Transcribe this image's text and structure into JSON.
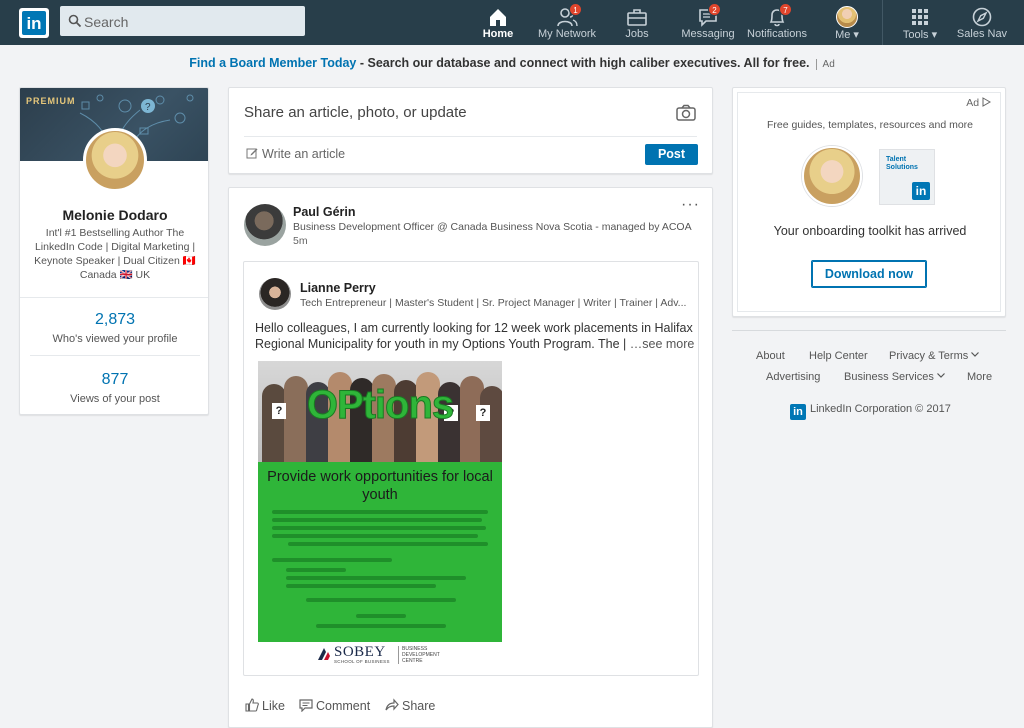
{
  "nav": {
    "search_placeholder": "Search",
    "items": [
      {
        "label": "Home",
        "icon": "home-icon"
      },
      {
        "label": "My Network",
        "icon": "people-icon",
        "badge": "1"
      },
      {
        "label": "Jobs",
        "icon": "briefcase-icon"
      },
      {
        "label": "Messaging",
        "icon": "messaging-icon",
        "badge": "2"
      },
      {
        "label": "Notifications",
        "icon": "bell-icon",
        "badge": "7"
      },
      {
        "label": "Me",
        "icon": "avatar"
      },
      {
        "label": "Tools",
        "icon": "grid-icon"
      },
      {
        "label": "Sales Nav",
        "icon": "compass-icon"
      }
    ],
    "active": "Home"
  },
  "ad_banner": {
    "link": "Find a Board Member Today",
    "separator": " - ",
    "text": "Search our database and connect with high caliber executives. All for free.",
    "tag": "Ad"
  },
  "profile": {
    "premium_label": "PREMIUM",
    "name": "Melonie Dodaro",
    "headline": "Int'l #1 Bestselling Author The LinkedIn Code | Digital Marketing | Keynote Speaker | Dual Citizen 🇨🇦 Canada 🇬🇧 UK",
    "stats": [
      {
        "value": "2,873",
        "label": "Who's viewed your profile"
      },
      {
        "value": "877",
        "label": "Views of your post"
      }
    ]
  },
  "share": {
    "prompt": "Share an article, photo, or update",
    "write_article": "Write an article",
    "post_label": "Post"
  },
  "post": {
    "author": "Paul Gérin",
    "headline": "Business Development Officer @ Canada Business Nova Scotia - managed by ACOA",
    "time": "5m",
    "more": "···",
    "shared": {
      "author": "Lianne Perry",
      "headline": "Tech Entrepreneur | Master's Student | Sr. Project Manager | Writer | Trainer | Adv...",
      "text": "Hello colleagues, I am currently looking for 12 week work placements in Halifax Regional Municipality for youth in my Options Youth Program. The |",
      "see_more": "…see more",
      "poster": {
        "title": "OPtions",
        "heading": "Provide work opportunities for local youth",
        "school": "SOBEY",
        "school_sub": "SCHOOL OF BUSINESS",
        "centre": "BUSINESS\nDEVELOPMENT\nCENTRE"
      }
    },
    "actions": [
      {
        "label": "Like",
        "icon": "thumbs-up-icon"
      },
      {
        "label": "Comment",
        "icon": "comment-icon"
      },
      {
        "label": "Share",
        "icon": "share-arrow-icon"
      }
    ]
  },
  "right_ad": {
    "tag": "Ad",
    "subtitle": "Free guides, templates, resources and more",
    "logo_text": "Talent\nSolutions",
    "logo_mark": "in",
    "message": "Your onboarding toolkit has arrived",
    "button": "Download now"
  },
  "footer": {
    "links": [
      "About",
      "Help Center",
      "Privacy & Terms",
      "Advertising",
      "Business Services",
      "More"
    ],
    "corporation": "LinkedIn Corporation © 2017",
    "logo_mark": "in"
  },
  "colors": {
    "nav_bg": "#283e4a",
    "brand_blue": "#0073b1",
    "badge_red": "#e0452c",
    "poster_green": "#2fb539"
  }
}
